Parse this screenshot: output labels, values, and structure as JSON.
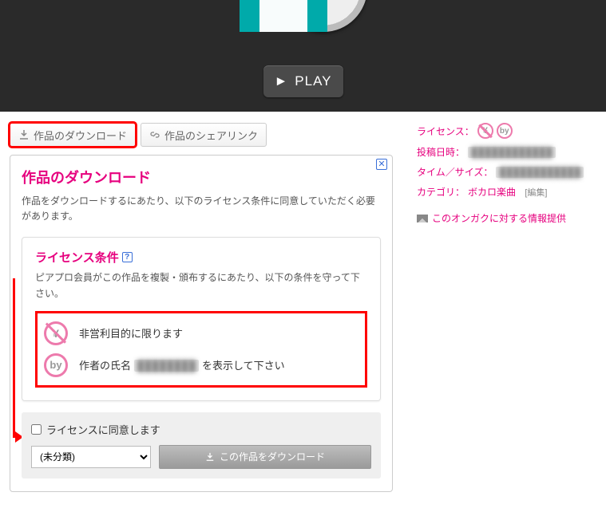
{
  "hero": {
    "play_label": "PLAY"
  },
  "tabs": {
    "download_label": "作品のダウンロード",
    "share_label": "作品のシェアリンク"
  },
  "panel": {
    "title": "作品のダウンロード",
    "lead": "作品をダウンロードするにあたり、以下のライセンス条件に同意していただく必要があります。"
  },
  "license": {
    "heading": "ライセンス条件",
    "sub": "ピアプロ会員がこの作品を複製・頒布するにあたり、以下の条件を守って下さい。",
    "cond_nonprofit": "非営利目的に限ります",
    "cond_by_prefix": "作者の氏名",
    "cond_by_suffix": "を表示して下さい",
    "yen_glyph": "¥",
    "by_glyph": "by"
  },
  "footer": {
    "agree_label": "ライセンスに同意します",
    "select_value": "(未分類)",
    "download_btn": "この作品をダウンロード"
  },
  "meta": {
    "license_lbl": "ライセンス：",
    "posted_lbl": "投稿日時：",
    "size_lbl": "タイム／サイズ：",
    "category_lbl": "カテゴリ：",
    "category_val": "ボカロ楽曲",
    "edit_label": "[編集]",
    "info_link": "このオンガクに対する情報提供"
  }
}
